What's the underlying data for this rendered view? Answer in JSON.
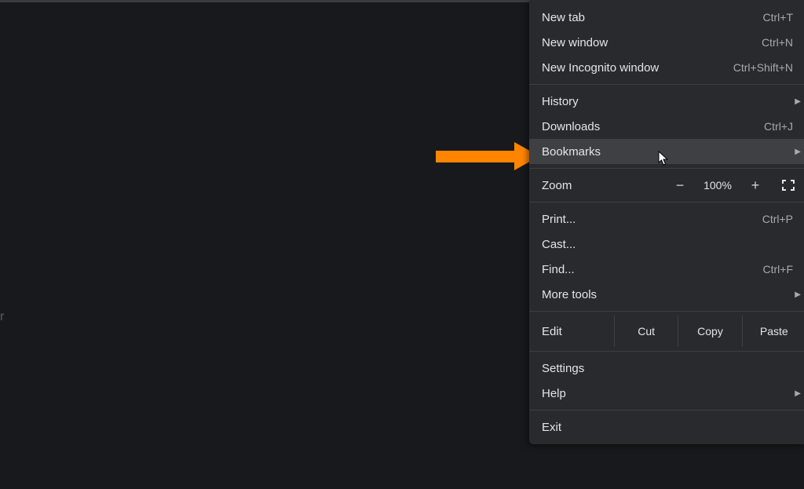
{
  "page_bg_text": "r",
  "menu": {
    "new_tab": {
      "label": "New tab",
      "shortcut": "Ctrl+T"
    },
    "new_window": {
      "label": "New window",
      "shortcut": "Ctrl+N"
    },
    "new_incognito": {
      "label": "New Incognito window",
      "shortcut": "Ctrl+Shift+N"
    },
    "history": {
      "label": "History"
    },
    "downloads": {
      "label": "Downloads",
      "shortcut": "Ctrl+J"
    },
    "bookmarks": {
      "label": "Bookmarks"
    },
    "zoom": {
      "label": "Zoom",
      "minus": "−",
      "value": "100%",
      "plus": "+"
    },
    "print": {
      "label": "Print...",
      "shortcut": "Ctrl+P"
    },
    "cast": {
      "label": "Cast..."
    },
    "find": {
      "label": "Find...",
      "shortcut": "Ctrl+F"
    },
    "more_tools": {
      "label": "More tools"
    },
    "edit": {
      "label": "Edit",
      "cut": "Cut",
      "copy": "Copy",
      "paste": "Paste"
    },
    "settings": {
      "label": "Settings"
    },
    "help": {
      "label": "Help"
    },
    "exit": {
      "label": "Exit"
    }
  },
  "colors": {
    "arrow": "#ff8500",
    "menu_bg": "#292a2d",
    "hover": "#3f4043"
  }
}
